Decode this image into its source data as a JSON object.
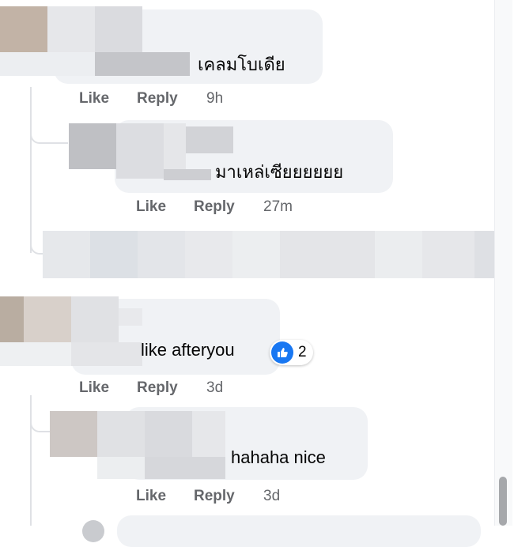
{
  "comments": [
    {
      "text": "เคลมโบเดีย",
      "actions": {
        "like": "Like",
        "reply": "Reply",
        "time": "9h"
      }
    },
    {
      "text": "มาเหล่เซียยยยยย",
      "actions": {
        "like": "Like",
        "reply": "Reply",
        "time": "27m"
      }
    },
    {
      "text": "like afteryou",
      "actions": {
        "like": "Like",
        "reply": "Reply",
        "time": "3d"
      },
      "reaction": {
        "icon": "thumbs-up-icon",
        "count": "2"
      }
    },
    {
      "text": "hahaha nice",
      "actions": {
        "like": "Like",
        "reply": "Reply",
        "time": "3d"
      }
    }
  ],
  "colors": {
    "bubble": "#f0f2f5",
    "action_text": "#65676b",
    "like_blue": "#1877f2",
    "thread_line": "#dfe1e5"
  }
}
